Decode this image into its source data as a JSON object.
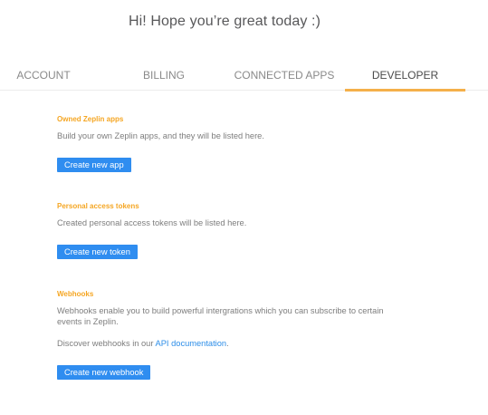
{
  "greeting": "Hi! Hope you’re great today :)",
  "tabs": [
    {
      "label": "ACCOUNT",
      "active": false
    },
    {
      "label": "BILLING",
      "active": false
    },
    {
      "label": "CONNECTED APPS",
      "active": false
    },
    {
      "label": "DEVELOPER",
      "active": true
    }
  ],
  "sections": {
    "apps": {
      "title": "Owned Zeplin apps",
      "description": "Build your own Zeplin apps, and they will be listed here.",
      "button": "Create new app"
    },
    "tokens": {
      "title": "Personal access tokens",
      "description": "Created personal access tokens will be listed here.",
      "button": "Create new token"
    },
    "webhooks": {
      "title": "Webhooks",
      "description": "Webhooks enable you to build powerful intergrations which you can subscribe to certain events in Zeplin.",
      "discover_prefix": "Discover webhooks in our ",
      "discover_link": "API documentation",
      "discover_suffix": ".",
      "button": "Create new webhook"
    }
  },
  "colors": {
    "accent": "#f5a623",
    "tab_underline": "#f5b04a",
    "button": "#2f8df0",
    "link": "#2d8ee8"
  }
}
